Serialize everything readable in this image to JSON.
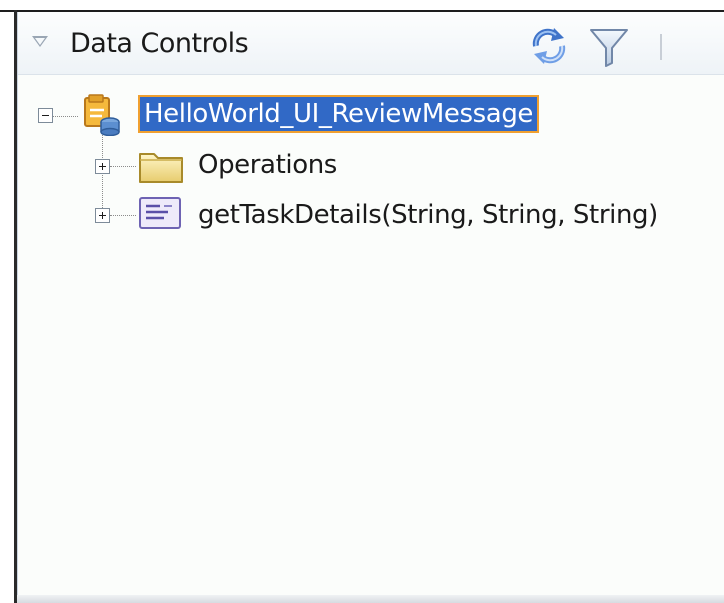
{
  "panel": {
    "title": "Data Controls",
    "header_icons": [
      "collapse-triangle-icon",
      "refresh-icon",
      "filter-icon"
    ]
  },
  "tree": {
    "root": {
      "label": "HelloWorld_UI_ReviewMessage",
      "icon": "data-control-icon",
      "expanded": true,
      "selected": true
    },
    "children": [
      {
        "label": "Operations",
        "icon": "folder-icon",
        "expanded": false
      },
      {
        "label": "getTaskDetails(String, String, String)",
        "icon": "method-icon",
        "expanded": false
      }
    ]
  },
  "colors": {
    "selection_bg": "#3169c6",
    "selection_border": "#f0a030",
    "panel_bg": "#fbfdfb"
  }
}
